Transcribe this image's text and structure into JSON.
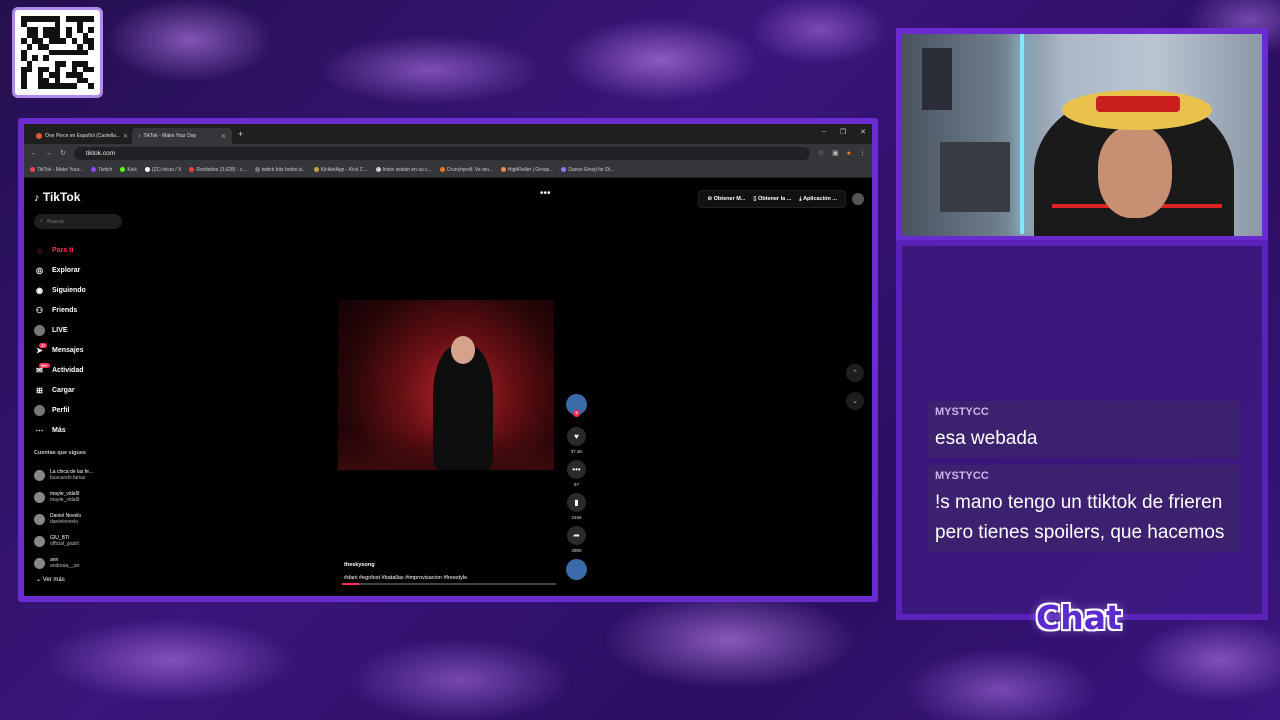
{
  "overlay": {
    "chat_label": "Chat"
  },
  "browser": {
    "tabs": [
      {
        "label": "One Piece en Español (Castella..."
      },
      {
        "label": "TikTok - Make Your Day"
      }
    ],
    "url": "tiktok.com",
    "bookmarks": [
      "TikTok - Make Your...",
      "Twitch",
      "Kick",
      "(21) Inicio / X",
      "Recibidos (3,628) - c...",
      "twitch bits botón d...",
      "KickletApp - Kick C...",
      "Inicie sesión en su c...",
      "Crunchyroll: Ve ani...",
      "HighRoller | Group...",
      "Dance Emoji for Di..."
    ]
  },
  "tiktok": {
    "logo": "TikTok",
    "search_placeholder": "Buscar",
    "nav": [
      {
        "label": "Para ti",
        "icon": "home-icon"
      },
      {
        "label": "Explorar",
        "icon": "compass-icon"
      },
      {
        "label": "Siguiendo",
        "icon": "following-icon"
      },
      {
        "label": "Friends",
        "icon": "friends-icon"
      },
      {
        "label": "LIVE",
        "icon": "live-icon"
      },
      {
        "label": "Mensajes",
        "icon": "messages-icon",
        "badge": "27"
      },
      {
        "label": "Actividad",
        "icon": "activity-icon",
        "badge": "99+"
      },
      {
        "label": "Cargar",
        "icon": "upload-icon"
      },
      {
        "label": "Perfil",
        "icon": "profile-icon"
      },
      {
        "label": "Más",
        "icon": "more-icon"
      }
    ],
    "following_title": "Cuentas que sigues",
    "following": [
      {
        "name": "La chica de las fe...",
        "handle": "buscando.farias"
      },
      {
        "name": "mayte_vidal9",
        "handle": "mayte_vidal9"
      },
      {
        "name": "Daniel Novelo",
        "handle": "danielnovelo"
      },
      {
        "name": "GIU_BTI",
        "handle": "official_giubti"
      },
      {
        "name": "ann",
        "handle": "andreaa__an"
      }
    ],
    "see_more": "Ver más",
    "top_buttons": [
      "Obtener M...",
      "Obtener la ...",
      "Aplicación ..."
    ],
    "video": {
      "username": "theskysong",
      "hashtags": "#dani #egofest #batallas #improvisacion #freestyle",
      "progress": 0.08
    },
    "actions": {
      "likes": "37.3K",
      "comments": "87",
      "saves": "2456",
      "shares": "2900"
    }
  },
  "chat": {
    "messages": [
      {
        "user": "MYSTYCC",
        "text": "esa webada"
      },
      {
        "user": "MYSTYCC",
        "text": "!s mano tengo un ttiktok de frieren pero tienes spoilers, que hacemos"
      }
    ]
  }
}
